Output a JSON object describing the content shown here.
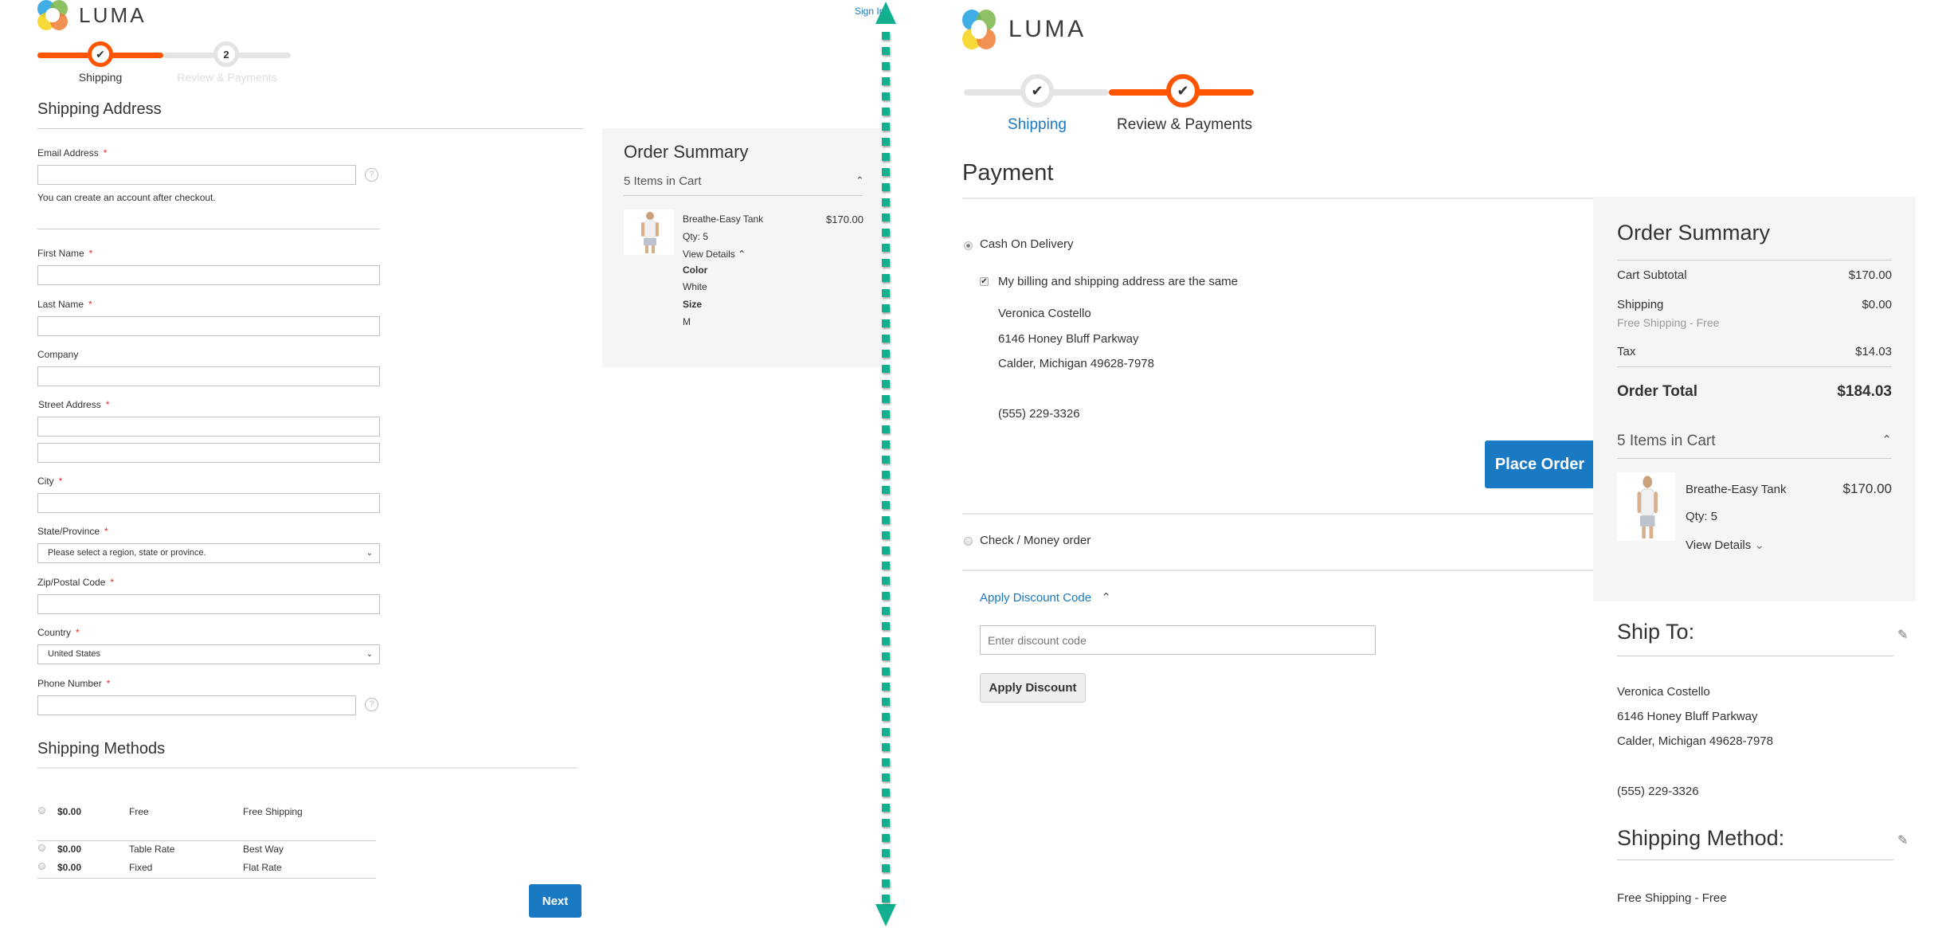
{
  "left": {
    "logo_text": "LUMA",
    "sign_in": "Sign In",
    "steps": [
      {
        "label": "Shipping",
        "marker": "✔",
        "state": "active"
      },
      {
        "label": "Review & Payments",
        "marker": "2",
        "state": "pending"
      }
    ],
    "shipping_address_heading": "Shipping Address",
    "email": {
      "label": "Email Address",
      "required": "*",
      "value": "",
      "note": "You can create an account after checkout.",
      "help": "?"
    },
    "fields": [
      {
        "label": "First Name",
        "required": "*",
        "value": ""
      },
      {
        "label": "Last Name",
        "required": "*",
        "value": ""
      },
      {
        "label": "Company",
        "required": "",
        "value": ""
      },
      {
        "label": "Street Address",
        "required": "*",
        "value": "",
        "value2": ""
      },
      {
        "label": "City",
        "required": "*",
        "value": ""
      },
      {
        "label": "State/Province",
        "required": "*",
        "selected": "Please select a region, state or province."
      },
      {
        "label": "Zip/Postal Code",
        "required": "*",
        "value": ""
      },
      {
        "label": "Country",
        "required": "*",
        "selected": "United States"
      },
      {
        "label": "Phone Number",
        "required": "*",
        "value": "",
        "help": "?"
      }
    ],
    "shipping_methods_heading": "Shipping Methods",
    "shipping_methods": [
      {
        "price": "$0.00",
        "method": "Free",
        "carrier": "Free Shipping"
      },
      {
        "price": "$0.00",
        "method": "Table Rate",
        "carrier": "Best Way"
      },
      {
        "price": "$0.00",
        "method": "Fixed",
        "carrier": "Flat Rate"
      }
    ],
    "next_button": "Next",
    "order_summary": {
      "title": "Order Summary",
      "items_in_cart": "5 Items in Cart",
      "item": {
        "name": "Breathe-Easy Tank",
        "qty": "Qty: 5",
        "price": "$170.00",
        "view_details": "View Details",
        "options": [
          {
            "label": "Color",
            "value": "White"
          },
          {
            "label": "Size",
            "value": "M"
          }
        ]
      }
    }
  },
  "arrow": {
    "direction": "vertical-bidirectional",
    "color": "#12b08e"
  },
  "right": {
    "logo_text": "LUMA",
    "steps": [
      {
        "label": "Shipping",
        "marker": "✔",
        "state": "complete"
      },
      {
        "label": "Review & Payments",
        "marker": "✔",
        "state": "active"
      }
    ],
    "payment_heading": "Payment",
    "payment_methods": [
      {
        "label": "Cash On Delivery",
        "selected": true
      },
      {
        "label": "Check / Money order",
        "selected": false
      }
    ],
    "billing_same_label": "My billing and shipping address are the same",
    "billing_same_checked": true,
    "billing_address": [
      "Veronica Costello",
      "6146 Honey Bluff Parkway",
      "Calder, Michigan 49628-7978",
      "",
      "(555) 229-3326"
    ],
    "place_order": "Place Order",
    "discount": {
      "toggle": "Apply Discount Code",
      "placeholder": "Enter discount code",
      "value": "",
      "button": "Apply Discount"
    },
    "order_summary": {
      "title": "Order Summary",
      "rows": [
        {
          "label": "Cart Subtotal",
          "value": "$170.00"
        },
        {
          "label": "Shipping",
          "sub": "Free Shipping - Free",
          "value": "$0.00"
        },
        {
          "label": "Tax",
          "value": "$14.03"
        }
      ],
      "total_label": "Order Total",
      "total_value": "$184.03",
      "items_in_cart": "5 Items in Cart",
      "item": {
        "name": "Breathe-Easy Tank",
        "qty": "Qty: 5",
        "price": "$170.00",
        "view_details": "View Details"
      }
    },
    "ship_to": {
      "title": "Ship To:",
      "lines": [
        "Veronica Costello",
        "6146 Honey Bluff Parkway",
        "Calder, Michigan 49628-7978",
        "",
        "(555) 229-3326"
      ]
    },
    "shipping_method": {
      "title": "Shipping Method:",
      "value": "Free Shipping - Free"
    }
  },
  "colors": {
    "accent": "#ff5501",
    "primary_button": "#1979c3",
    "link": "#1979c3",
    "summary_bg": "#f5f5f5",
    "step_inactive": "#e4e4e4"
  }
}
